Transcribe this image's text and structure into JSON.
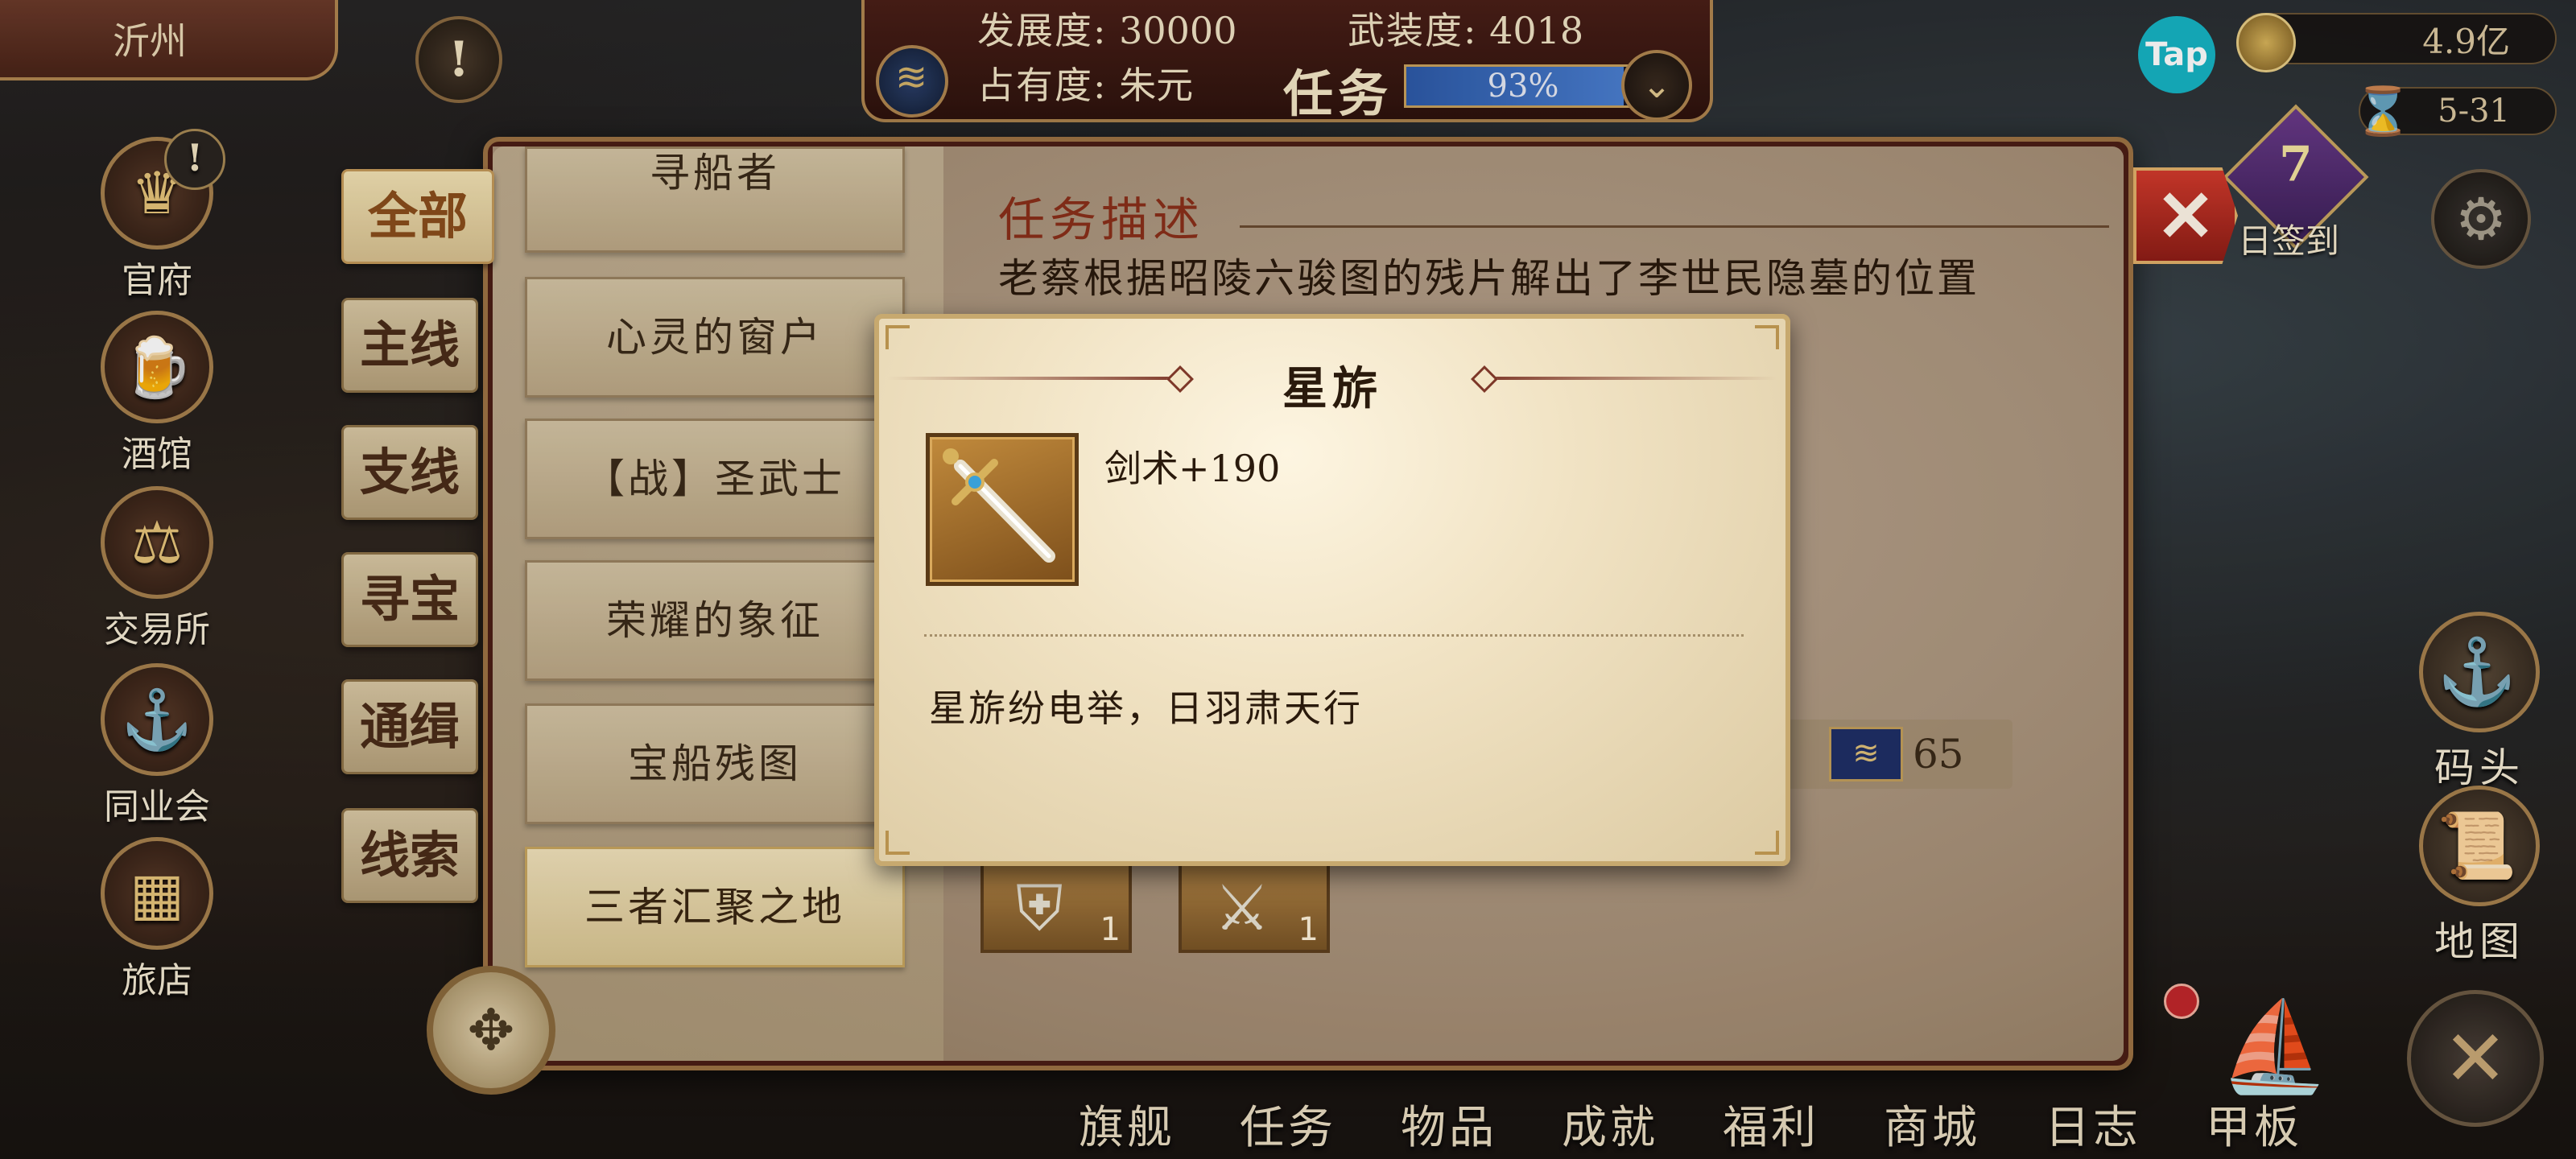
{
  "header": {
    "city": "沂州",
    "stats": {
      "development_label": "发展度:",
      "development_value": "30000",
      "military_label": "武装度:",
      "military_value": "4018",
      "occupancy_label": "占有度:",
      "occupancy_value": "朱元"
    },
    "task_label": "任务",
    "task_progress_text": "93%",
    "task_progress_fraction": 0.93,
    "currency": "4.9亿",
    "date": "5-31",
    "checkin_days": "7",
    "checkin_label": "日签到"
  },
  "left_menu": [
    {
      "label": "官府",
      "icon": "crown-icon"
    },
    {
      "label": "酒馆",
      "icon": "beer-mug-icon"
    },
    {
      "label": "交易所",
      "icon": "scales-icon"
    },
    {
      "label": "同业会",
      "icon": "anchor-shield-icon"
    },
    {
      "label": "旅店",
      "icon": "chest-icon"
    }
  ],
  "right_menu": [
    {
      "label": "码头",
      "icon": "dock-icon"
    },
    {
      "label": "地图",
      "icon": "map-scroll-icon"
    }
  ],
  "bottom_nav": [
    "旗舰",
    "任务",
    "物品",
    "成就",
    "福利",
    "商城",
    "日志",
    "甲板"
  ],
  "mission_window": {
    "category_tabs": [
      "全部",
      "主线",
      "支线",
      "寻宝",
      "通缉",
      "线索"
    ],
    "active_tab": "全部",
    "missions": [
      "寻船者",
      "心灵的窗户",
      "【战】圣武士",
      "荣耀的象征",
      "宝船残图",
      "三者汇聚之地"
    ],
    "selected_mission": "三者汇聚之地",
    "description_title": "任务描述",
    "description_text": "老蔡根据昭陵六骏图的残片解出了李世民隐墓的位置",
    "reward_chip_value": "65",
    "reward_items": [
      {
        "icon": "armor-icon",
        "count": "1"
      },
      {
        "icon": "sword-icon",
        "count": "1"
      }
    ]
  },
  "item_popup": {
    "title": "星旂",
    "stat": "剑术+190",
    "flavor": "星旂纷电举，日羽肃天行",
    "icon": "ornate-sword-icon"
  },
  "colors": {
    "accent_gold": "#c7a96f",
    "close_red": "#d23a2c",
    "progress_blue": "#2d5aa8"
  }
}
